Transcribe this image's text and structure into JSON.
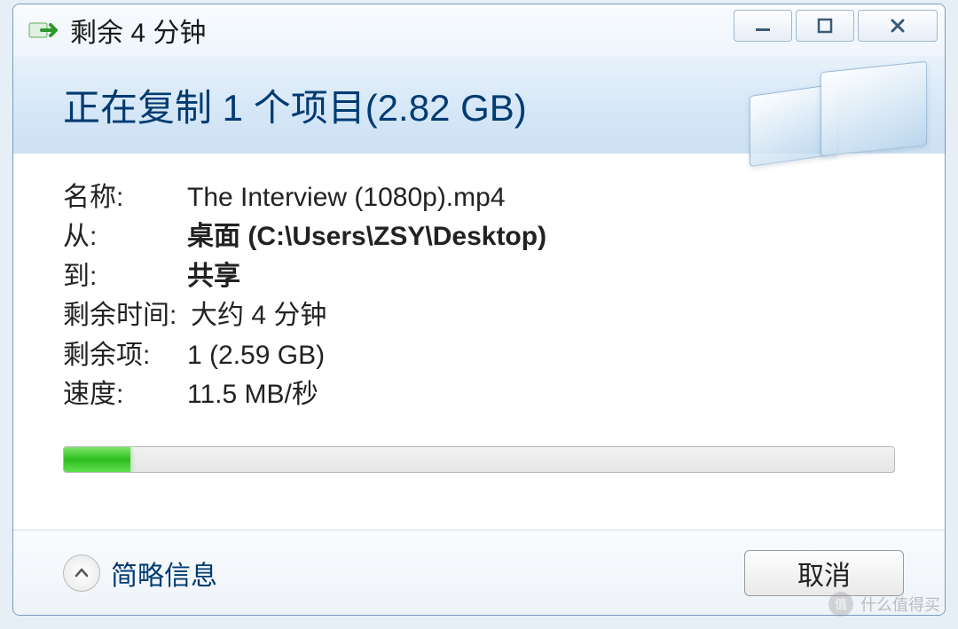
{
  "window": {
    "title": "剩余 4 分钟"
  },
  "header": {
    "heading": "正在复制 1 个项目(2.82 GB)"
  },
  "details": {
    "name_label": "名称:",
    "name_value": "The Interview (1080p).mp4",
    "from_label": "从:",
    "from_value": "桌面 (C:\\Users\\ZSY\\Desktop)",
    "to_label": "到:",
    "to_value": "共享",
    "time_remaining_label": "剩余时间:",
    "time_remaining_value": "大约 4 分钟",
    "items_remaining_label": "剩余项:",
    "items_remaining_value": "1 (2.59 GB)",
    "speed_label": "速度:",
    "speed_value": "11.5 MB/秒"
  },
  "progress": {
    "percent": 8
  },
  "footer": {
    "toggle_label": "简略信息",
    "cancel_label": "取消"
  },
  "watermark": {
    "text": "什么值得买",
    "badge": "值"
  }
}
